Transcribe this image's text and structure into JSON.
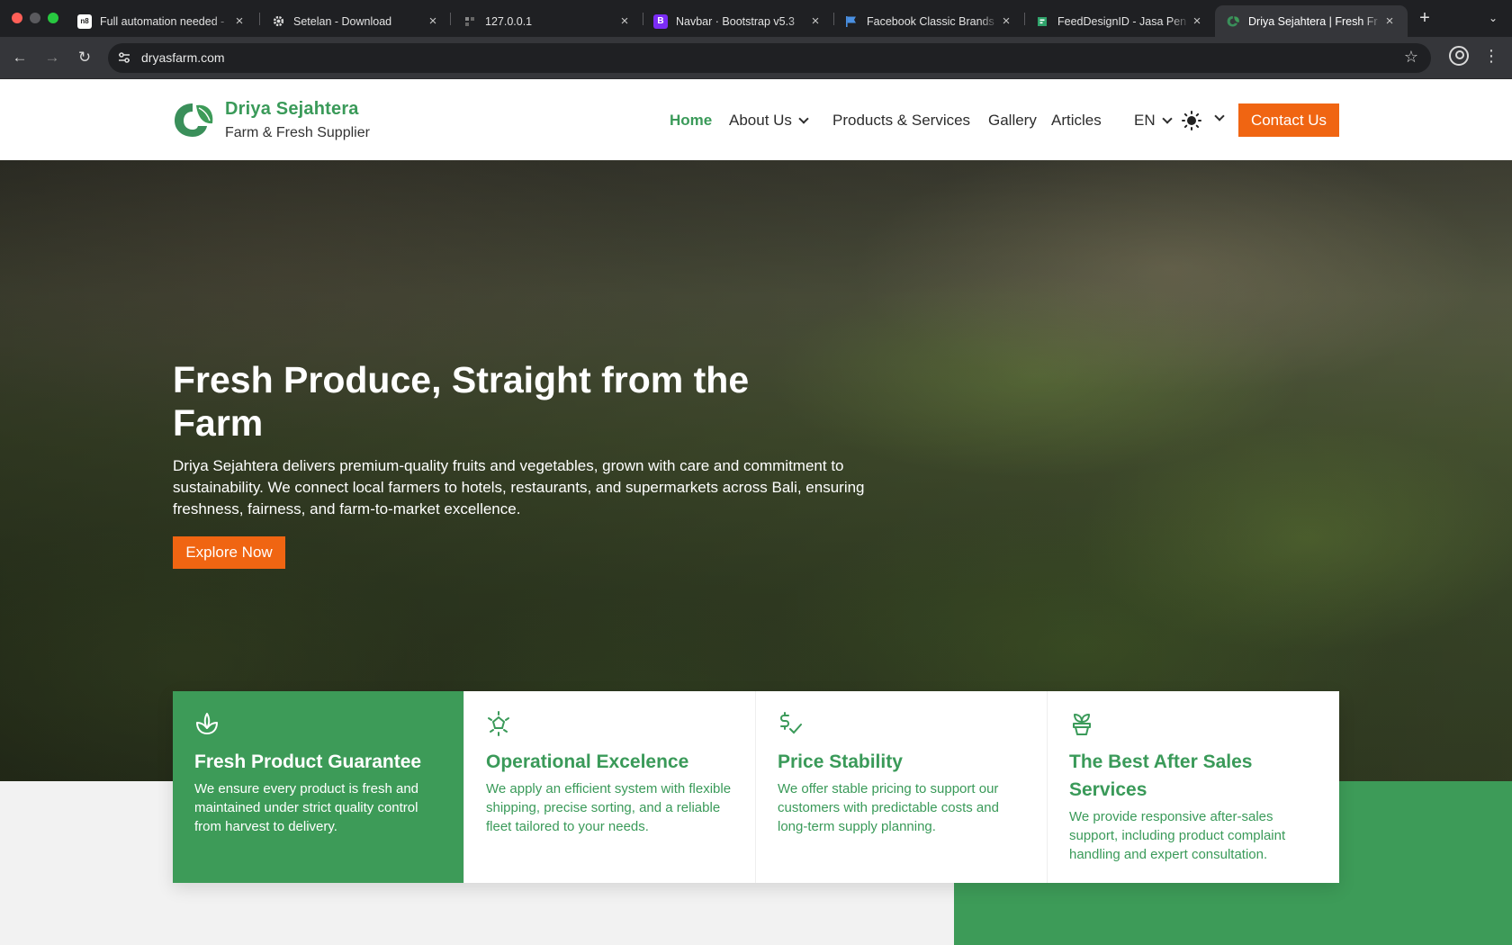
{
  "browser": {
    "tabs": [
      {
        "title": "Full automation needed -",
        "active": false
      },
      {
        "title": "Setelan - Download",
        "active": false
      },
      {
        "title": "127.0.0.1",
        "active": false
      },
      {
        "title": "Navbar · Bootstrap v5.3",
        "active": false,
        "favicon_letter": "B"
      },
      {
        "title": "Facebook Classic Brands",
        "active": false
      },
      {
        "title": "FeedDesignID - Jasa Pen",
        "active": false
      },
      {
        "title": "Driya Sejahtera | Fresh Fr",
        "active": true
      }
    ],
    "url": "dryasfarm.com"
  },
  "site": {
    "brand": "Driya Sejahtera",
    "tagline": "Farm & Fresh Supplier",
    "nav": {
      "home": "Home",
      "about": "About Us",
      "products": "Products & Services",
      "gallery": "Gallery",
      "articles": "Articles",
      "lang": "EN",
      "contact": "Contact Us"
    },
    "accent_color": "#3d9b58",
    "cta_color": "#f06512"
  },
  "hero": {
    "title": "Fresh Produce, Straight from the Farm",
    "description": "Driya Sejahtera delivers premium-quality fruits and vegetables, grown with care and commitment to sustainability. We connect local farmers to hotels, restaurants, and supermarkets across Bali, ensuring freshness, fairness, and farm-to-market excellence.",
    "cta": "Explore Now"
  },
  "features": [
    {
      "icon": "leaf-icon",
      "title": "Fresh Product Guarantee",
      "description": "We ensure every product is fresh and maintained under strict quality control from harvest to delivery."
    },
    {
      "icon": "sparkle-icon",
      "title": "Operational Excelence",
      "description": "We apply an efficient system with flexible shipping, precise sorting, and a reliable fleet tailored to your needs."
    },
    {
      "icon": "dollar-check-icon",
      "title": "Price Stability",
      "description": "We offer stable pricing to support our customers with predictable costs and long-term supply planning."
    },
    {
      "icon": "sprout-pot-icon",
      "title": "The Best After Sales Services",
      "description": "We provide responsive after-sales support, including product complaint handling and expert consultation."
    }
  ]
}
